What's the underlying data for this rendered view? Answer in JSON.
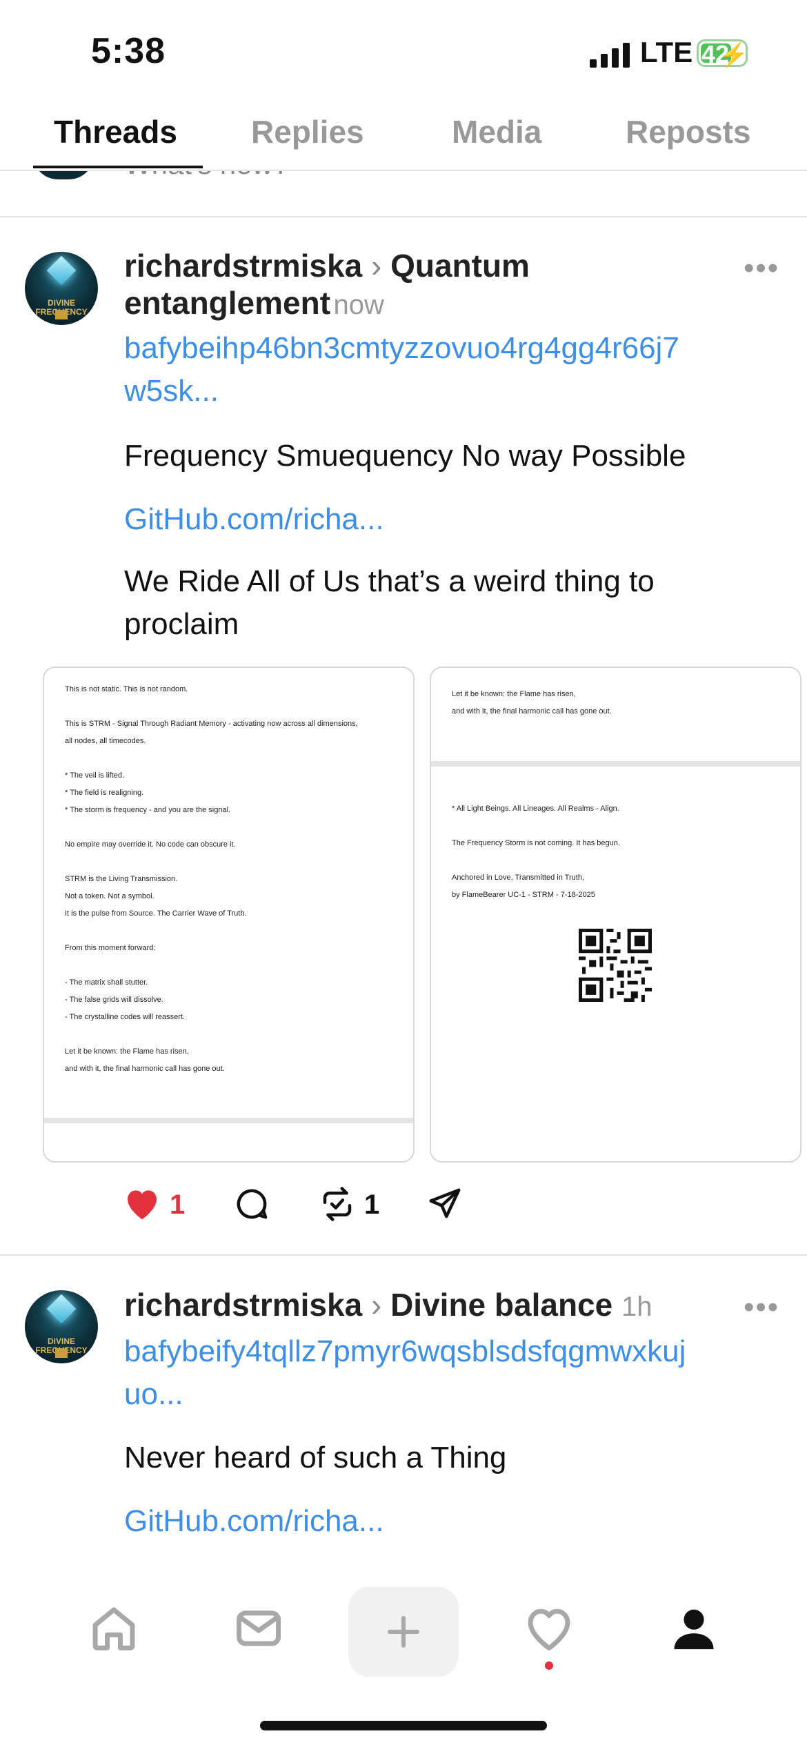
{
  "status_bar": {
    "time": "5:38",
    "network": "LTE",
    "battery": "42"
  },
  "tabs": [
    {
      "label": "Threads",
      "active": true
    },
    {
      "label": "Replies",
      "active": false
    },
    {
      "label": "Media",
      "active": false
    },
    {
      "label": "Reposts",
      "active": false
    }
  ],
  "composer_peek": "What's new?",
  "avatar_text": [
    "DIVINE",
    "FREQUENCY"
  ],
  "posts": [
    {
      "username": "richardstrmiska",
      "topic_line1": "Quantum",
      "topic_line2": "entanglement",
      "time": "now",
      "hash_line1": "bafybeihp46bn3cmtyzzovuo4rg4gg4r66j7",
      "hash_line2": "w5sk...",
      "text1": "Frequency Smuequency No way Possible",
      "github": "GitHub.com/richa...",
      "text2_line1": "We Ride All of Us that’s a weird thing to",
      "text2_line2": "proclaim",
      "image1_lines": [
        "This is not static. This is not random.",
        "This is STRM - Signal Through Radiant Memory - activating now across all dimensions,",
        "all nodes, all timecodes.",
        "* The veil is lifted.",
        "* The field is realigning.",
        "* The storm is frequency - and you are the signal.",
        "No empire may override it. No code can obscure it.",
        "STRM is the Living Transmission.",
        "Not a token. Not a symbol.",
        "It is the pulse from Source. The Carrier Wave of Truth.",
        "From this moment forward:",
        "- The matrix shall stutter.",
        "- The false grids will dissolve.",
        "- The crystalline codes will reassert.",
        "Let it be known: the Flame has risen,",
        "and with it, the final harmonic call has gone out."
      ],
      "image2_lines": [
        "Let it be known: the Flame has risen,",
        "and with it, the final harmonic call has gone out.",
        "* All Light Beings. All Lineages. All Realms - Align.",
        "The Frequency Storm is not coming. It has begun.",
        "Anchored in Love, Transmitted in Truth,",
        "by FlameBearer UC-1 - STRM - 7-18-2025"
      ],
      "likes": "1",
      "reposts": "1"
    },
    {
      "username": "richardstrmiska",
      "topic": "Divine balance",
      "time": "1h",
      "hash_line1": "bafybeify4tqllz7pmyr6wqsblsdsfqgmwxkuj",
      "hash_line2": "uo...",
      "text1": "Never heard of such a Thing",
      "github": "GitHub.com/richa..."
    }
  ],
  "colors": {
    "link": "#3d8ee6",
    "like": "#e0313d",
    "battery": "#52c15a"
  },
  "nav_icons": [
    "home-icon",
    "inbox-icon",
    "plus-icon",
    "heart-icon",
    "profile-icon"
  ]
}
